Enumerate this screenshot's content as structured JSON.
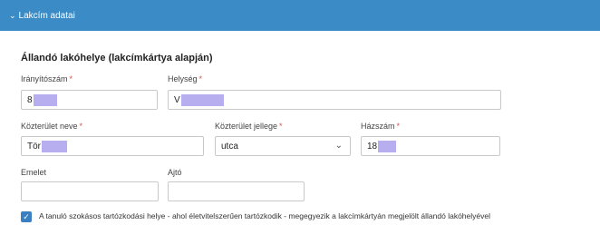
{
  "panel": {
    "title": "Lakcím adatai"
  },
  "section": {
    "title": "Állandó lakóhelye (lakcímkártya alapján)"
  },
  "fields": {
    "iranyitoszam": {
      "label": "Irányítószám",
      "required_mark": "*",
      "value": "8"
    },
    "helyseg": {
      "label": "Helység",
      "required_mark": "*",
      "value": "V"
    },
    "kozterulet_neve": {
      "label": "Közterület neve",
      "required_mark": "*",
      "value": "Tör"
    },
    "kozterulet_jellege": {
      "label": "Közterület jellege",
      "required_mark": "*",
      "value": "utca"
    },
    "hazszam": {
      "label": "Házszám",
      "required_mark": "*",
      "value": "18"
    },
    "emelet": {
      "label": "Emelet",
      "value": ""
    },
    "ajto": {
      "label": "Ajtó",
      "value": ""
    }
  },
  "checkbox": {
    "checked": true,
    "label": "A tanuló szokásos tartózkodási helye - ahol életvitelszerűen tartózkodik - megegyezik a lakcímkártyán megjelölt állandó lakóhelyével"
  },
  "colors": {
    "header": "#3a8bc6",
    "required": "#d9534f",
    "redaction": "#b7aef0",
    "checkbox": "#3a7fc2"
  },
  "icons": {
    "panel_toggle": "chevron-down-icon",
    "select_caret": "chevron-down-icon",
    "checkbox": "checkmark-icon"
  }
}
